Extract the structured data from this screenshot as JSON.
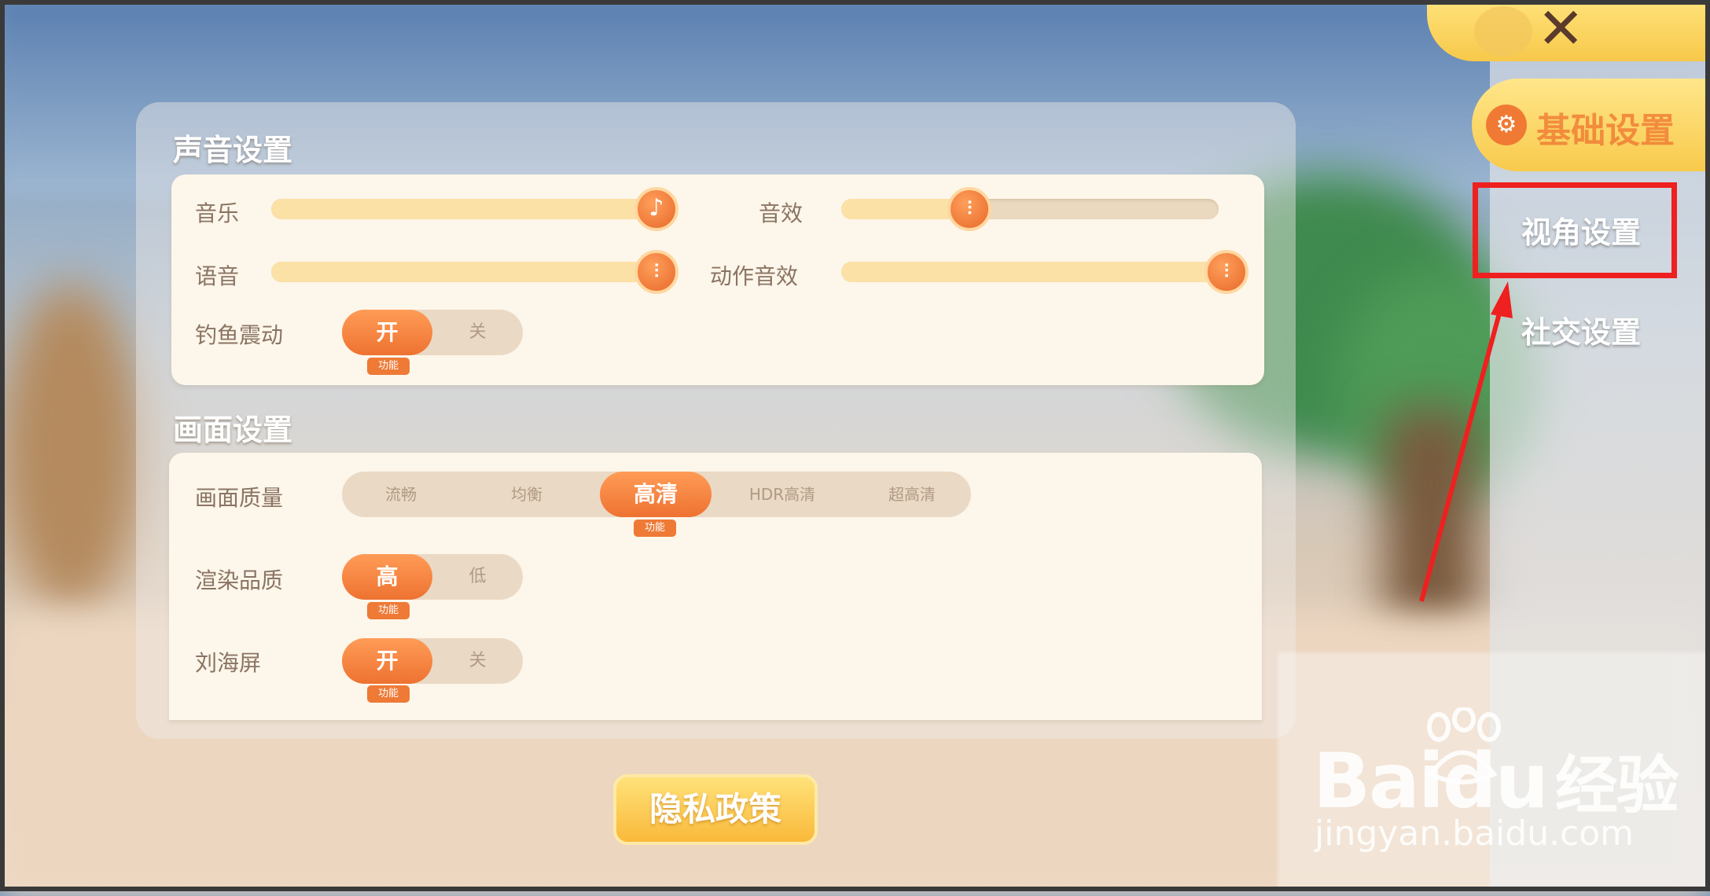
{
  "sound": {
    "title": "声音设置",
    "music_label": "音乐",
    "music_level": 1.0,
    "sfx_label": "音效",
    "sfx_level": 0.34,
    "voice_label": "语音",
    "voice_level": 1.0,
    "action_sfx_label": "动作音效",
    "action_sfx_level": 1.0,
    "fishing_label": "钓鱼震动",
    "fishing_on": "开",
    "fishing_off": "关",
    "fishing_tag": "功能"
  },
  "picture": {
    "title": "画面设置",
    "quality_label": "画面质量",
    "quality_options": [
      "流畅",
      "均衡",
      "高清",
      "HDR高清",
      "超高清"
    ],
    "quality_selected": "高清",
    "quality_tag": "功能",
    "render_label": "渲染品质",
    "render_on": "高",
    "render_off": "低",
    "render_tag": "功能",
    "notch_label": "刘海屏",
    "notch_on": "开",
    "notch_off": "关",
    "notch_tag": "功能"
  },
  "privacy_button": "隐私政策",
  "nav": {
    "basic": "基础设置",
    "view": "视角设置",
    "social": "社交设置"
  },
  "watermark": {
    "logo": "Baidu",
    "logo_cn": "经验",
    "url": "jingyan.baidu.com"
  },
  "colors": {
    "accent": "#ee7231",
    "highlight": "#ee2020",
    "yellow": "#f8ca4c"
  }
}
